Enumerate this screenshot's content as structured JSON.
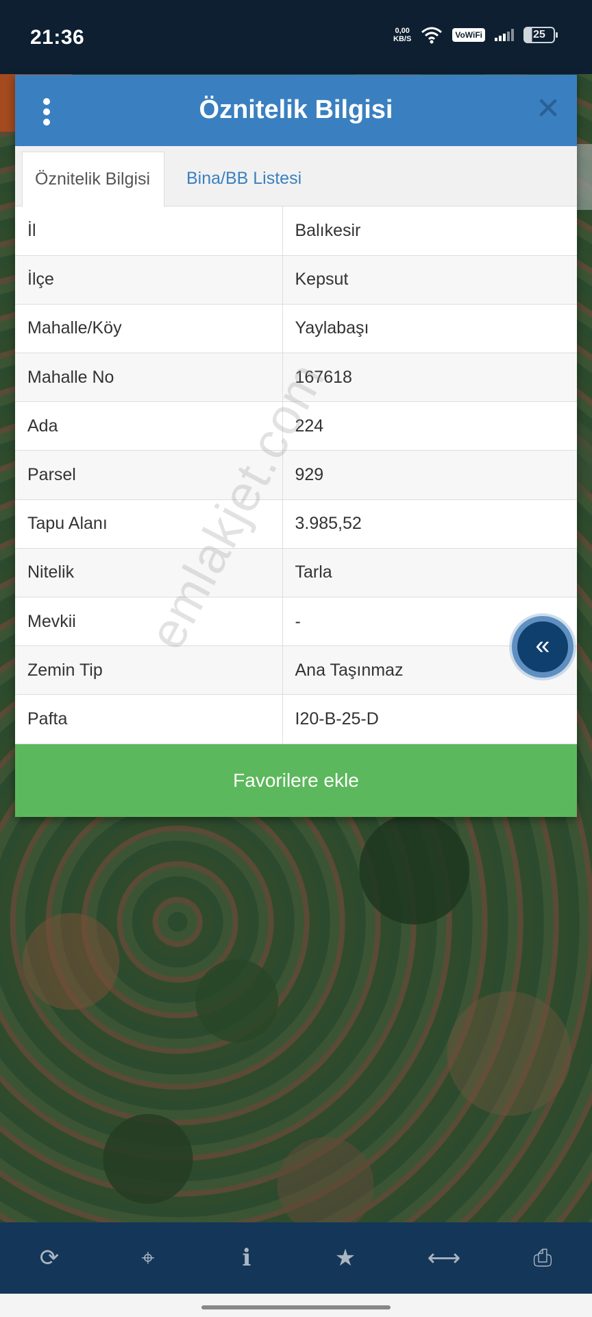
{
  "status_bar": {
    "time": "21:36",
    "net_speed_value": "0,00",
    "net_speed_unit": "KB/S",
    "vowifi": "VoWiFi",
    "battery": "25"
  },
  "dialog": {
    "title": "Öznitelik Bilgisi",
    "close_label": "✕",
    "tabs": [
      {
        "label": "Öznitelik Bilgisi",
        "active": true
      },
      {
        "label": "Bina/BB Listesi",
        "active": false
      }
    ],
    "rows": [
      {
        "key": "İl",
        "value": "Balıkesir"
      },
      {
        "key": "İlçe",
        "value": "Kepsut"
      },
      {
        "key": "Mahalle/Köy",
        "value": "Yaylabaşı"
      },
      {
        "key": "Mahalle No",
        "value": "167618"
      },
      {
        "key": "Ada",
        "value": "224"
      },
      {
        "key": "Parsel",
        "value": "929"
      },
      {
        "key": "Tapu Alanı",
        "value": "3.985,52"
      },
      {
        "key": "Nitelik",
        "value": "Tarla"
      },
      {
        "key": "Mevkii",
        "value": "-"
      },
      {
        "key": "Zemin Tip",
        "value": "Ana Taşınmaz"
      },
      {
        "key": "Pafta",
        "value": "I20-B-25-D"
      }
    ],
    "favorite_button": "Favorilere ekle"
  },
  "fab_label": "«",
  "watermark": "emlakjet.com",
  "toolbar": {
    "icons": [
      "refresh-icon",
      "locate-icon",
      "info-icon",
      "star-icon",
      "measure-icon",
      "print-icon"
    ],
    "glyphs": [
      "⟳",
      "⌖",
      "ℹ",
      "★",
      "⟷",
      "⎙"
    ]
  },
  "colors": {
    "header": "#3a80c1",
    "favorite": "#5cb85c",
    "toolbar": "#143659",
    "status_bar": "#0d1f30"
  }
}
